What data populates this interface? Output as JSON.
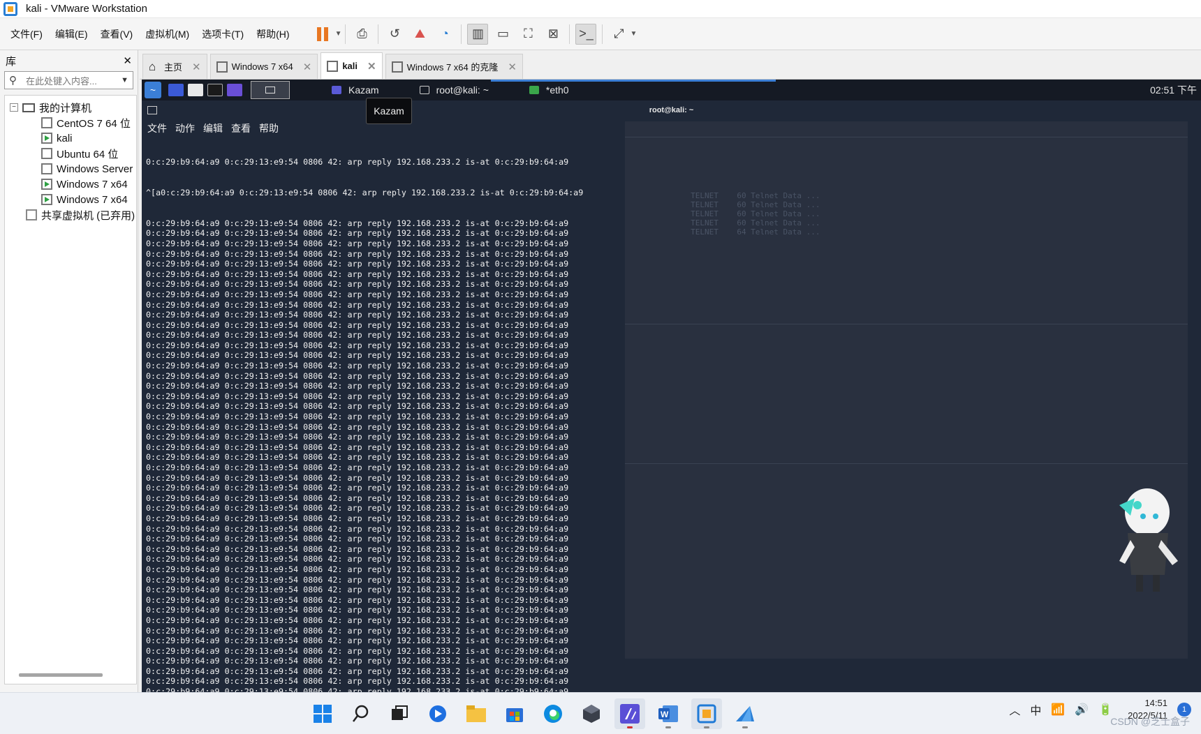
{
  "window": {
    "title": "kali - VMware Workstation"
  },
  "menubar": {
    "items": [
      "文件(F)",
      "编辑(E)",
      "查看(V)",
      "虚拟机(M)",
      "选项卡(T)",
      "帮助(H)"
    ]
  },
  "toolbar": {
    "icons": [
      "pause-icon",
      "send-ctrl-alt-del-icon",
      "snapshot-icon",
      "revert-snapshot-icon",
      "snapshot-manager-icon",
      "library-view-icon",
      "thumbnail-view-icon",
      "fullscreen-icon",
      "unity-icon",
      "console-view-icon",
      "stretch-icon"
    ]
  },
  "library": {
    "title": "库",
    "close": "✕",
    "search_placeholder": "在此处键入内容...",
    "tree": {
      "root": "我的计算机",
      "vms": [
        "CentOS 7 64 位",
        "kali",
        "Ubuntu 64 位",
        "Windows Server",
        "Windows 7 x64",
        "Windows 7 x64"
      ],
      "shared": "共享虚拟机 (已弃用)"
    }
  },
  "tabs": [
    {
      "label": "主页",
      "active": false
    },
    {
      "label": "Windows 7 x64",
      "active": false
    },
    {
      "label": "kali",
      "active": true
    },
    {
      "label": "Windows 7 x64 的克隆",
      "active": false
    }
  ],
  "vm": {
    "taskbar": {
      "tasks": [
        "Kazam",
        "root@kali: ~",
        "*eth0"
      ],
      "clock": "02:51 下午"
    },
    "tooltip": "Kazam",
    "terminal_title": "root@kali: ~",
    "terminal_menu": [
      "文件",
      "动作",
      "编辑",
      "查看",
      "帮助"
    ],
    "terminal": {
      "first_line": "0:c:29:b9:64:a9 0:c:29:13:e9:54 0806 42: arp reply 192.168.233.2 is-at 0:c:29:b9:64:a9",
      "second_line": "^[a0:c:29:b9:64:a9 0:c:29:13:e9:54 0806 42: arp reply 192.168.233.2 is-at 0:c:29:b9:64:a9",
      "repeat_line": "0:c:29:b9:64:a9 0:c:29:13:e9:54 0806 42: arp reply 192.168.233.2 is-at 0:c:29:b9:64:a9",
      "repeat_count": 48
    }
  },
  "windows_taskbar": {
    "apps": [
      "start-icon",
      "search-icon",
      "task-view-icon",
      "app-blue-icon",
      "file-explorer-icon",
      "store-icon",
      "edge-icon",
      "cube-app-icon",
      "ide-app-icon",
      "word-icon",
      "vmware-icon",
      "shark-app-icon"
    ],
    "tray": {
      "ime": "中",
      "time": "14:51",
      "date": "2022/5/11",
      "notifications": "1"
    }
  },
  "watermark": "CSDN @芝士盒子"
}
